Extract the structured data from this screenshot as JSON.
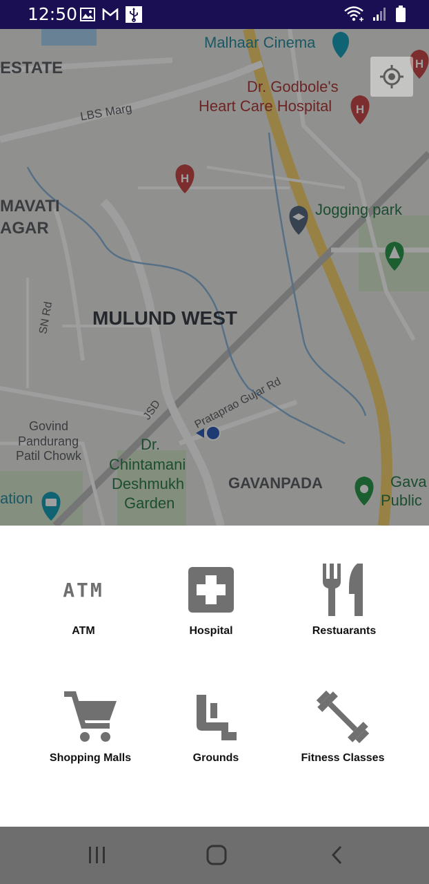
{
  "status_bar": {
    "time": "12:50",
    "left_icons": [
      "image-icon",
      "gmail-icon",
      "usb-icon"
    ],
    "right_icons": [
      "wifi-icon",
      "signal-icon",
      "battery-icon"
    ]
  },
  "map": {
    "labels": {
      "malhaar_cinema": "Malhaar Cinema",
      "estate": "ESTATE",
      "lbs_marg": "LBS Marg",
      "godbole_1": "Dr. Godbole's",
      "godbole_2": "Heart Care Hospital",
      "mavati": "MAVATI",
      "agar": "AGAR",
      "jogging_park": "Jogging park",
      "sn_rd": "SN Rd",
      "mulund_west": "MULUND WEST",
      "jsd": "JSD",
      "gujar_rd": "Prataprao Gujar Rd",
      "govind_1": "Govind",
      "govind_2": "Pandurang",
      "govind_3": "Patil Chowk",
      "chintamani_1": "Dr.",
      "chintamani_2": "Chintamani",
      "chintamani_3": "Deshmukh",
      "chintamani_4": "Garden",
      "gavanpada": "GAVANPADA",
      "gava_1": "Gava",
      "gava_2": "Public",
      "ation": "ation"
    }
  },
  "categories": [
    {
      "label": "ATM",
      "icon": "atm-icon"
    },
    {
      "label": "Hospital",
      "icon": "hospital-icon"
    },
    {
      "label": "Restuarants",
      "icon": "restaurant-icon"
    },
    {
      "label": "Shopping Malls",
      "icon": "shopping-cart-icon"
    },
    {
      "label": "Grounds",
      "icon": "seat-icon"
    },
    {
      "label": "Fitness Classes",
      "icon": "dumbbell-icon"
    }
  ],
  "atm_glyph": "ATM",
  "nav_bar": {
    "icons": [
      "recent-apps-icon",
      "home-icon",
      "back-icon"
    ]
  }
}
